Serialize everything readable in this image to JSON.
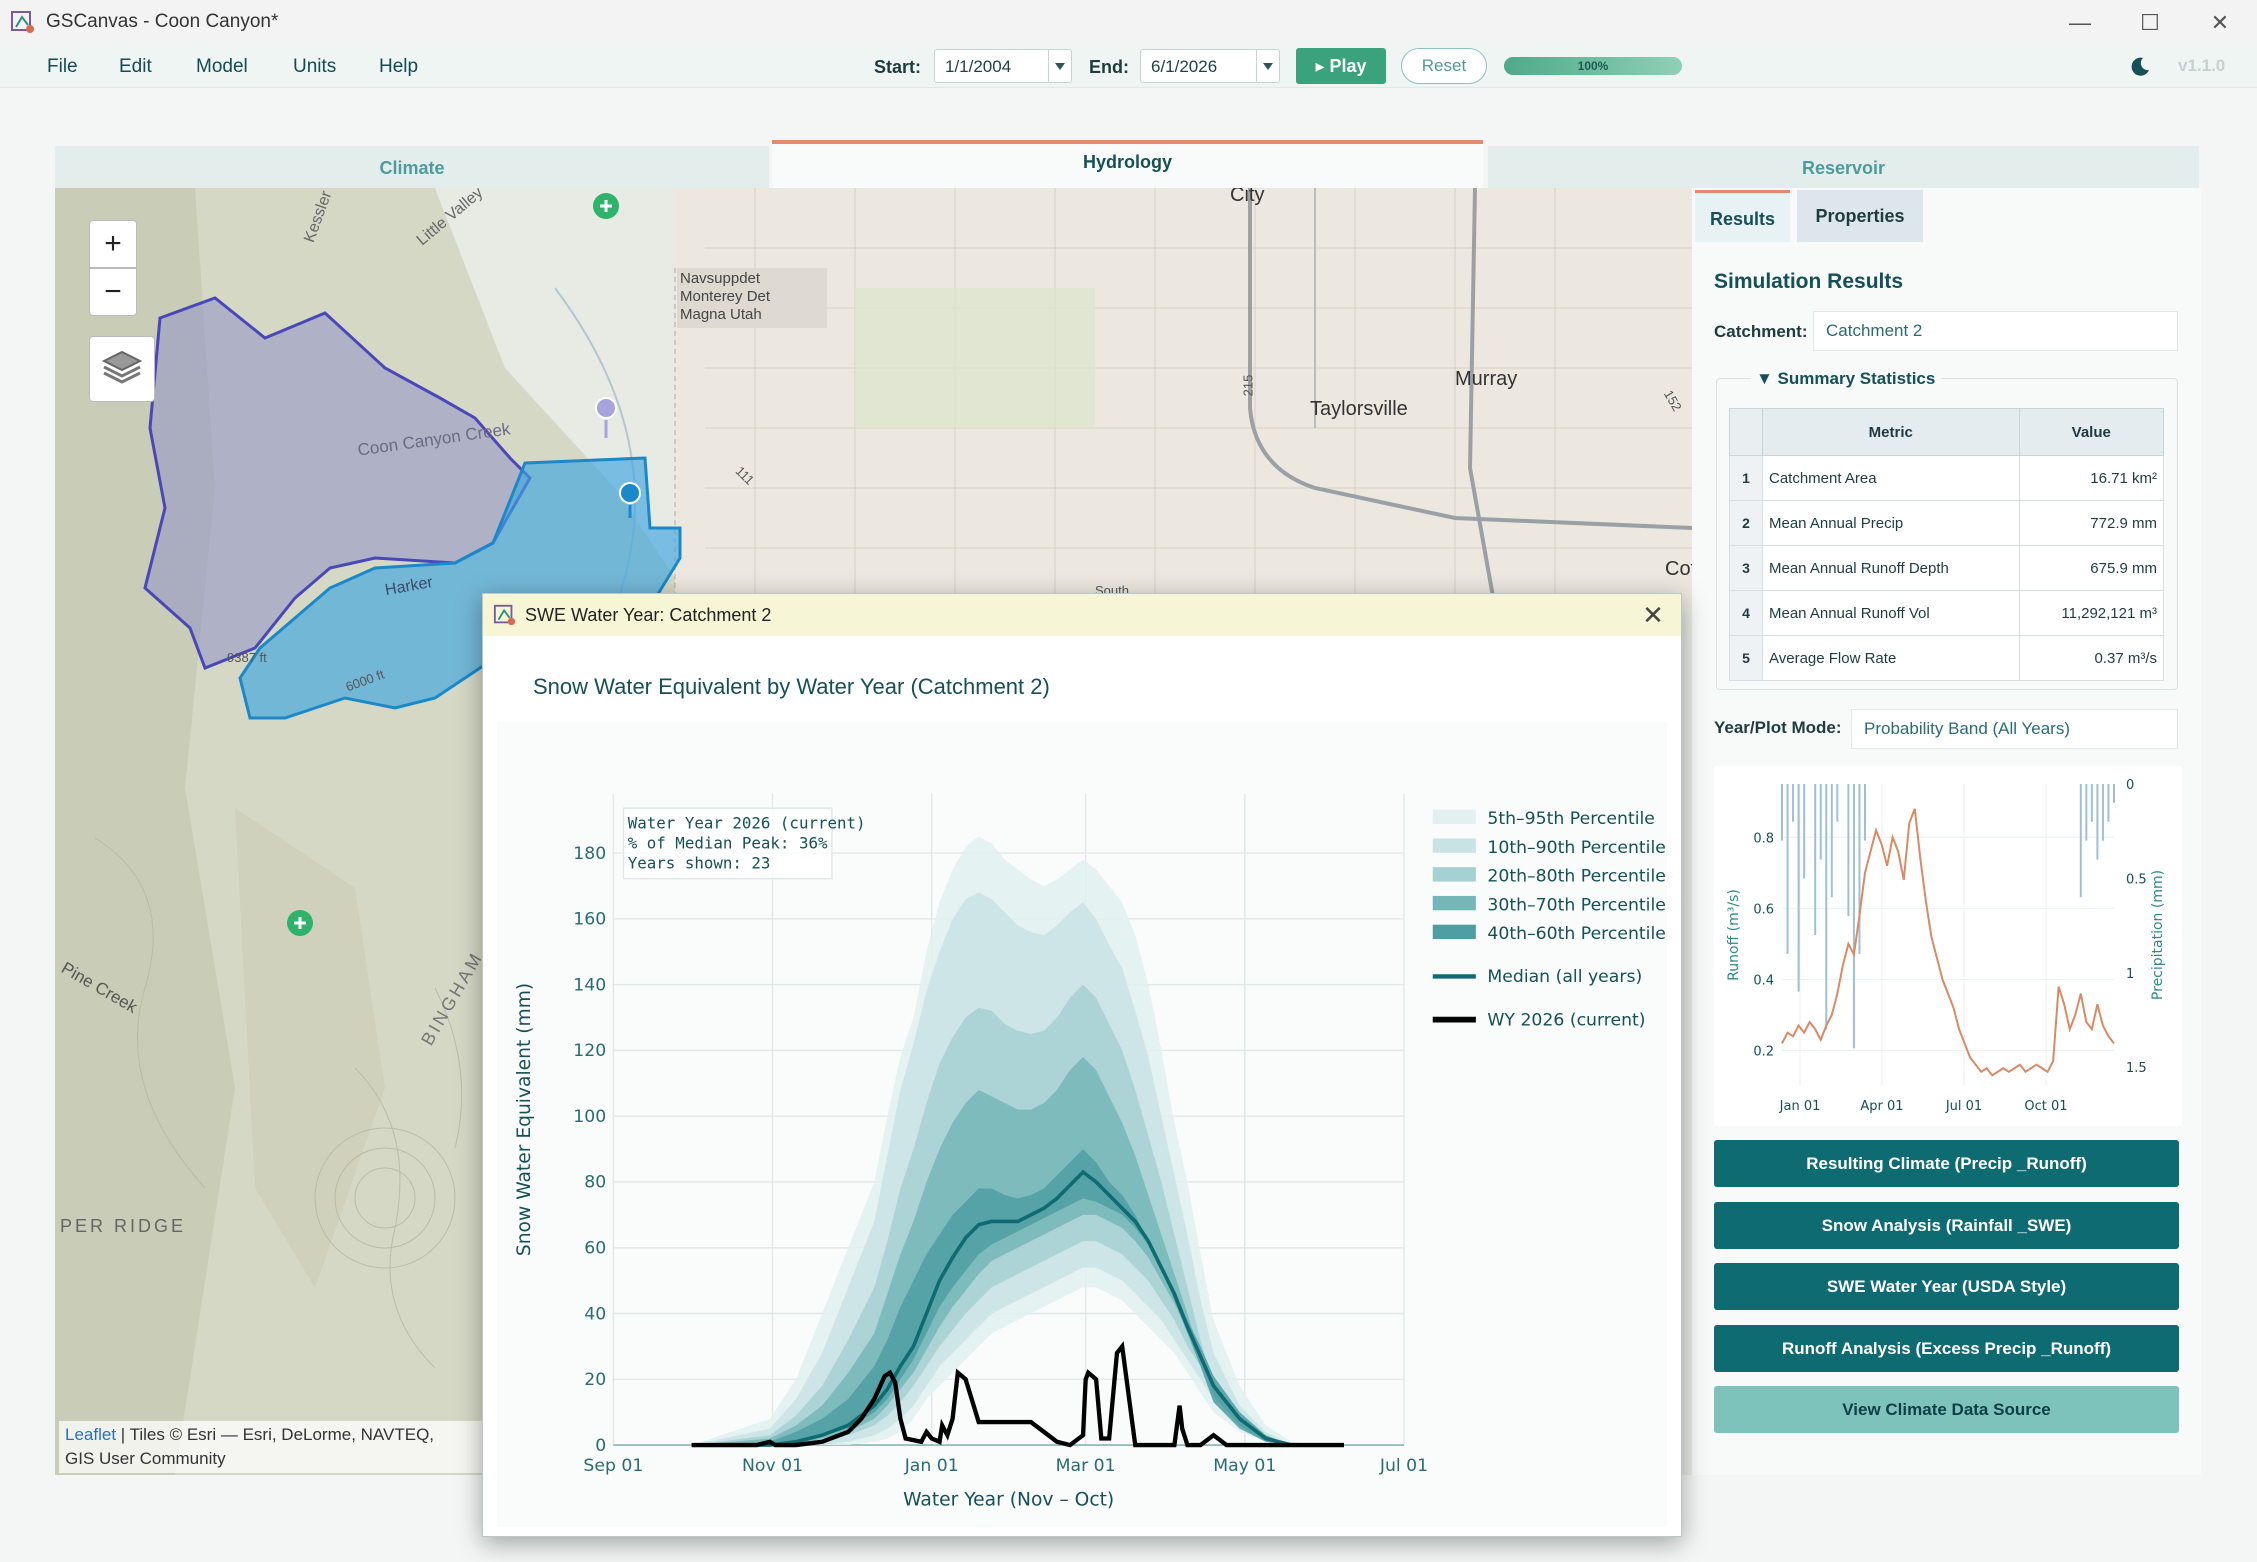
{
  "window": {
    "title": "GSCanvas - Coon Canyon*",
    "minimize": "—",
    "maximize": "☐",
    "close": "✕"
  },
  "menu": [
    "File",
    "Edit",
    "Model",
    "Units",
    "Help"
  ],
  "toolbar": {
    "start_label": "Start:",
    "start_value": "1/1/2004",
    "end_label": "End:",
    "end_value": "6/1/2026",
    "play_label": "▸ Play",
    "reset_label": "Reset",
    "progress": 1.0,
    "progress_text": "100%",
    "theme_icon": "moon-icon",
    "version": "v1.1.0"
  },
  "tabs": [
    "Climate",
    "Hydrology",
    "Reservoir"
  ],
  "active_tab": "Hydrology",
  "map": {
    "zoom_in": "+",
    "zoom_out": "−",
    "labels": [
      "City",
      "Taylorsville",
      "Murray",
      "Navsuppdet",
      "Monterey Det",
      "Magna Utah",
      "Coon Canyon Creek",
      "Harker",
      "Pine Creek",
      "PER RIDGE",
      "BINGHAM",
      "Kessler",
      "Little Valley",
      "Cott",
      "215",
      "111",
      "152",
      "9387 ft",
      "6000 ft",
      "South"
    ],
    "attribution_link": "Leaflet",
    "attribution_text": "| Tiles © Esri — Esri, DeLorme, NAVTEQ,",
    "attribution_line2": "GIS User Community",
    "colors": {
      "catchment1": "#8f93c8",
      "catchment2": "#3ea6e0"
    }
  },
  "side": {
    "tabs": [
      "Results",
      "Properties"
    ],
    "title": "Simulation Results",
    "catchment_label": "Catchment:",
    "catchment_value": "Catchment 2",
    "summary_title": "▼ Summary Statistics",
    "table_headers": [
      "Metric",
      "Value"
    ],
    "rows": [
      {
        "idx": "1",
        "metric": "Catchment Area",
        "value": "16.71 km²"
      },
      {
        "idx": "2",
        "metric": "Mean Annual Precip",
        "value": "772.9 mm"
      },
      {
        "idx": "3",
        "metric": "Mean Annual Runoff Depth",
        "value": "675.9 mm"
      },
      {
        "idx": "4",
        "metric": "Mean Annual Runoff Vol",
        "value": "11,292,121 m³"
      },
      {
        "idx": "5",
        "metric": "Average Flow Rate",
        "value": "0.37 m³/s"
      }
    ],
    "mode_label": "Year/Plot Mode:",
    "mode_value": "Probability Band (All Years)",
    "buttons": [
      "Resulting Climate (Precip _Runoff)",
      "Snow Analysis (Rainfall _SWE)",
      "SWE Water Year (USDA Style)",
      "Runoff Analysis (Excess Precip _Runoff)",
      "View Climate Data Source"
    ]
  },
  "mini_chart": {
    "type": "line",
    "xlabels": [
      "Jan 01",
      "Apr 01",
      "Jul 01",
      "Oct 01"
    ],
    "y_label": "Runoff (m³/s)",
    "y_ticks": [
      "0.2",
      "0.4",
      "0.6",
      "0.8"
    ],
    "ylim": [
      0.1,
      0.95
    ],
    "y2_label": "Precipitation (mm)",
    "y2_ticks": [
      "0",
      "0.5",
      "1",
      "1.5"
    ],
    "y2lim": [
      0,
      1.6
    ],
    "series_color": "#d98a65",
    "bar_color": "#9fbfd6",
    "runoff": [
      0.22,
      0.25,
      0.24,
      0.27,
      0.25,
      0.28,
      0.26,
      0.23,
      0.27,
      0.3,
      0.36,
      0.44,
      0.5,
      0.47,
      0.58,
      0.7,
      0.76,
      0.82,
      0.78,
      0.72,
      0.8,
      0.76,
      0.68,
      0.84,
      0.88,
      0.74,
      0.62,
      0.52,
      0.46,
      0.4,
      0.36,
      0.32,
      0.26,
      0.22,
      0.18,
      0.16,
      0.14,
      0.15,
      0.13,
      0.14,
      0.15,
      0.14,
      0.15,
      0.16,
      0.14,
      0.15,
      0.16,
      0.15,
      0.14,
      0.17,
      0.38,
      0.33,
      0.26,
      0.3,
      0.36,
      0.28,
      0.26,
      0.33,
      0.27,
      0.24,
      0.22
    ],
    "precip": [
      0.3,
      0.9,
      0.2,
      1.1,
      0.5,
      0,
      0.8,
      0.4,
      1.3,
      0.6,
      0.2,
      0,
      0.7,
      1.4,
      0.9,
      0.3,
      0,
      0,
      0,
      0,
      0,
      0,
      0,
      0,
      0,
      0,
      0,
      0,
      0,
      0,
      0,
      0,
      0,
      0,
      0,
      0,
      0,
      0,
      0,
      0,
      0,
      0,
      0,
      0,
      0,
      0,
      0,
      0,
      0,
      0,
      0,
      0,
      0,
      0,
      0.6,
      0.3,
      0.2,
      0.4,
      0.3,
      0.2,
      0.1
    ]
  },
  "popup": {
    "window_title": "SWE Water Year: Catchment 2",
    "heading": "Snow Water Equivalent by Water Year (Catchment 2)",
    "close": "✕"
  },
  "chart_data": {
    "type": "area",
    "xlabel": "Water Year (Nov – Oct)",
    "ylabel": "Snow Water Equivalent (mm)",
    "x_ticks": [
      "Sep 01",
      "Nov 01",
      "Jan 01",
      "Mar 01",
      "May 01",
      "Jul 01"
    ],
    "x_tick_days": [
      0,
      61,
      122,
      181,
      242,
      303
    ],
    "y_ticks": [
      0,
      20,
      40,
      60,
      80,
      100,
      120,
      140,
      160,
      180
    ],
    "ylim": [
      0,
      198
    ],
    "xlim": [
      0,
      303
    ],
    "grid": true,
    "legend_position": "right",
    "annotation": [
      "Water Year 2026 (current)",
      "% of Median Peak: 36%",
      "Years shown: 23"
    ],
    "x": [
      30,
      60,
      70,
      80,
      90,
      100,
      105,
      110,
      115,
      120,
      125,
      130,
      135,
      140,
      145,
      150,
      155,
      160,
      165,
      170,
      175,
      180,
      185,
      190,
      195,
      200,
      205,
      210,
      215,
      220,
      225,
      230,
      240,
      250,
      260,
      270,
      280
    ],
    "bands": [
      {
        "name": "5th–95th Percentile",
        "color": "#e2f0f0",
        "lo": [
          0,
          0,
          0,
          0,
          0,
          1,
          2,
          4,
          8,
          14,
          18,
          22,
          26,
          30,
          34,
          36,
          38,
          40,
          42,
          44,
          46,
          48,
          48,
          46,
          44,
          40,
          36,
          32,
          28,
          22,
          16,
          10,
          4,
          1,
          0,
          0,
          0
        ],
        "hi": [
          0,
          8,
          20,
          40,
          60,
          80,
          100,
          118,
          130,
          150,
          165,
          175,
          182,
          185,
          183,
          178,
          175,
          172,
          170,
          172,
          175,
          178,
          175,
          170,
          165,
          155,
          140,
          120,
          98,
          80,
          58,
          38,
          18,
          6,
          1,
          0,
          0
        ]
      },
      {
        "name": "10th–90th Percentile",
        "color": "#c9e3e4",
        "lo": [
          0,
          0,
          0,
          0,
          1,
          3,
          5,
          8,
          12,
          18,
          24,
          28,
          32,
          36,
          40,
          42,
          44,
          46,
          48,
          50,
          52,
          54,
          54,
          52,
          50,
          46,
          42,
          38,
          32,
          26,
          20,
          14,
          6,
          2,
          0,
          0,
          0
        ],
        "hi": [
          0,
          5,
          14,
          28,
          48,
          68,
          88,
          108,
          122,
          138,
          150,
          160,
          166,
          168,
          166,
          162,
          158,
          156,
          155,
          158,
          162,
          165,
          160,
          152,
          145,
          132,
          118,
          100,
          82,
          64,
          44,
          28,
          12,
          4,
          0,
          0,
          0
        ]
      },
      {
        "name": "20th–80th Percentile",
        "color": "#a6d1d2",
        "lo": [
          0,
          0,
          0,
          1,
          3,
          6,
          9,
          13,
          18,
          24,
          30,
          35,
          40,
          44,
          48,
          50,
          52,
          54,
          56,
          58,
          60,
          62,
          62,
          60,
          58,
          54,
          50,
          44,
          38,
          30,
          24,
          16,
          8,
          2,
          0,
          0,
          0
        ],
        "hi": [
          0,
          3,
          9,
          18,
          32,
          48,
          62,
          78,
          90,
          104,
          116,
          124,
          130,
          133,
          132,
          128,
          126,
          125,
          126,
          130,
          136,
          140,
          136,
          128,
          120,
          108,
          94,
          80,
          64,
          48,
          32,
          18,
          8,
          2,
          0,
          0,
          0
        ]
      },
      {
        "name": "30th–70th Percentile",
        "color": "#75b6b9",
        "lo": [
          0,
          0,
          0,
          2,
          4,
          8,
          12,
          17,
          22,
          29,
          36,
          42,
          47,
          52,
          56,
          58,
          60,
          62,
          64,
          66,
          68,
          70,
          70,
          68,
          66,
          62,
          57,
          50,
          43,
          35,
          28,
          19,
          9,
          3,
          0,
          0,
          0
        ],
        "hi": [
          0,
          2,
          6,
          12,
          22,
          34,
          46,
          58,
          68,
          80,
          90,
          98,
          104,
          108,
          106,
          104,
          102,
          102,
          104,
          108,
          114,
          118,
          114,
          106,
          98,
          88,
          76,
          64,
          52,
          40,
          27,
          15,
          6,
          1,
          0,
          0,
          0
        ]
      },
      {
        "name": "40th–60th Percentile",
        "color": "#4e9ea3",
        "lo": [
          0,
          0,
          0,
          3,
          5,
          10,
          14,
          20,
          26,
          34,
          42,
          48,
          53,
          58,
          61,
          63,
          65,
          67,
          69,
          71,
          73,
          75,
          74,
          72,
          70,
          66,
          61,
          54,
          46,
          38,
          30,
          21,
          10,
          3,
          0,
          0,
          0
        ],
        "hi": [
          0,
          1,
          4,
          8,
          14,
          24,
          32,
          42,
          50,
          58,
          64,
          70,
          74,
          78,
          78,
          76,
          75,
          76,
          78,
          82,
          86,
          90,
          86,
          80,
          76,
          70,
          62,
          54,
          44,
          34,
          24,
          13,
          5,
          1,
          0,
          0,
          0
        ]
      }
    ],
    "series": [
      {
        "name": "Median (all years)",
        "color": "#0e6b72",
        "values": [
          0,
          0,
          1,
          3,
          6,
          12,
          17,
          24,
          30,
          40,
          50,
          57,
          63,
          67,
          68,
          68,
          68,
          70,
          72,
          75,
          79,
          83,
          80,
          76,
          72,
          68,
          62,
          54,
          46,
          36,
          27,
          18,
          8,
          2,
          0,
          0,
          0
        ]
      }
    ],
    "current": {
      "name": "WY 2026 (current)",
      "color": "#000000",
      "x": [
        30,
        55,
        60,
        62,
        65,
        70,
        80,
        90,
        95,
        100,
        104,
        106,
        108,
        110,
        112,
        118,
        120,
        122,
        125,
        126,
        128,
        130,
        132,
        135,
        140,
        145,
        150,
        155,
        160,
        165,
        170,
        175,
        180,
        181,
        182,
        185,
        187,
        190,
        193,
        195,
        200,
        210,
        215,
        217,
        218,
        220,
        225,
        230,
        235,
        240,
        245,
        280
      ],
      "y": [
        0,
        0,
        1,
        0,
        0,
        0,
        1,
        4,
        8,
        14,
        21,
        22,
        19,
        8,
        2,
        1,
        4,
        2,
        1,
        6,
        3,
        8,
        22,
        20,
        7,
        7,
        7,
        7,
        7,
        4,
        1,
        0,
        3,
        20,
        22,
        20,
        2,
        2,
        28,
        30,
        0,
        0,
        0,
        12,
        5,
        0,
        0,
        3,
        0,
        0,
        0,
        0
      ]
    }
  }
}
